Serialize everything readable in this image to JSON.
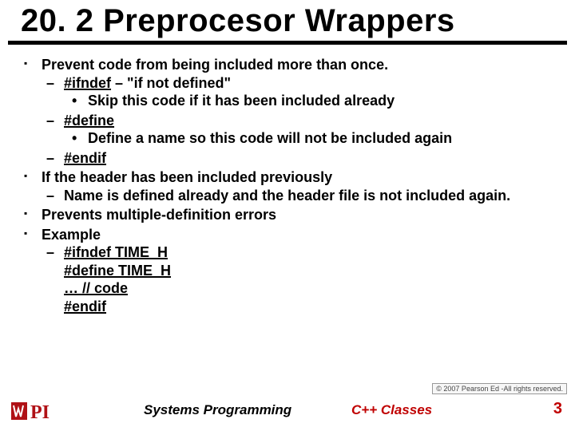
{
  "title": "20. 2 Preprocesor Wrappers",
  "bullets": {
    "b1": "Prevent code from being included more than once.",
    "b1a_prefix": "#ifndef",
    "b1a_suffix": " – \"if not defined\"",
    "b1a_i": "Skip this code if it has been included already",
    "b1b": "#define",
    "b1b_i": "Define a name so this code will not be included again",
    "b1c": "#endif",
    "b2": "If the header has been included previously",
    "b2a": "Name is defined already and the header file is not included again.",
    "b3": "Prevents multiple-definition errors",
    "b4": "Example",
    "b4a": "#ifndef TIME_H",
    "b4b": "#define TIME_H",
    "b4c": "… // code",
    "b4d": "#endif"
  },
  "footer": {
    "center": "Systems Programming",
    "right": "C++ Classes",
    "page": "3"
  },
  "copyright": "© 2007 Pearson Ed -All rights reserved."
}
